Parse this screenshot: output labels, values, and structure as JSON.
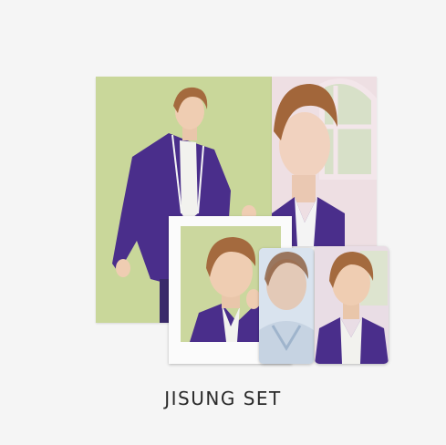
{
  "product": {
    "title": "JISUNG SET"
  },
  "colors": {
    "background": "#f5f5f5",
    "poster_left_bg": "#c9d79a",
    "poster_right_bg": "#efe0e4",
    "blazer": "#4b2f8c"
  },
  "items": [
    {
      "name": "poster-left",
      "icon": "portrait-photo"
    },
    {
      "name": "poster-right",
      "icon": "portrait-photo"
    },
    {
      "name": "polaroid",
      "icon": "portrait-photo"
    },
    {
      "name": "photocard-a",
      "icon": "portrait-photo"
    },
    {
      "name": "photocard-b",
      "icon": "portrait-photo"
    }
  ]
}
